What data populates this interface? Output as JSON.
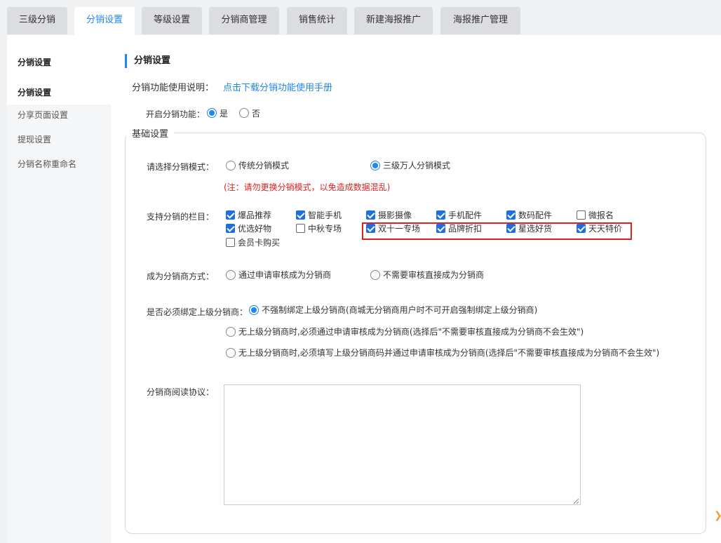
{
  "tabs": [
    "三级分销",
    "分销设置",
    "等级设置",
    "分销商管理",
    "销售统计",
    "新建海报推广",
    "海报推广管理"
  ],
  "sidebar": {
    "title": "分销设置",
    "items": [
      "分销设置",
      "分享页面设置",
      "提现设置",
      "分销名称重命名"
    ]
  },
  "main": {
    "section_title": "分销设置",
    "manual_label": "分销功能使用说明：",
    "manual_link": "点击下载分销功能使用手册",
    "enable_label": "开启分销功能：",
    "enable_yes": "是",
    "enable_no": "否",
    "fieldset_legend": "基础设置",
    "mode_label": "请选择分销模式：",
    "mode_options": [
      "传统分销模式",
      "三级万人分销模式"
    ],
    "mode_warning": "(注：请勿更换分销模式，以免造成数据混乱)",
    "columns_label": "支持分销的栏目：",
    "columns": [
      {
        "label": "爆品推荐",
        "checked": true
      },
      {
        "label": "智能手机",
        "checked": true
      },
      {
        "label": "摄影摄像",
        "checked": true
      },
      {
        "label": "手机配件",
        "checked": true
      },
      {
        "label": "数码配件",
        "checked": true
      },
      {
        "label": "微报名",
        "checked": false
      },
      {
        "label": "优选好物",
        "checked": true
      },
      {
        "label": "中秋专场",
        "checked": false
      },
      {
        "label": "双十一专场",
        "checked": true
      },
      {
        "label": "品牌折扣",
        "checked": true
      },
      {
        "label": "星选好货",
        "checked": true
      },
      {
        "label": "天天特价",
        "checked": true
      },
      {
        "label": "会员卡购买",
        "checked": false
      }
    ],
    "become_label": "成为分销商方式：",
    "become_options": [
      "通过申请审核成为分销商",
      "不需要审核直接成为分销商"
    ],
    "bind_label": "是否必须绑定上级分销商：",
    "bind_options": [
      "不强制绑定上级分销商(商城无分销商用户时不可开启强制绑定上级分销商)",
      "无上级分销商时,必须通过申请审核成为分销商(选择后\"不需要审核直接成为分销商不会生效\")",
      "无上级分销商时,必须填写上级分销商码并通过申请审核成为分销商(选择后\"不需要审核直接成为分销商不会生效\")"
    ],
    "agreement_label": "分销商阅读协议："
  },
  "colors": {
    "accent": "#1e87f0",
    "warning": "#e02020",
    "checkbox": "#1e6fe0"
  }
}
